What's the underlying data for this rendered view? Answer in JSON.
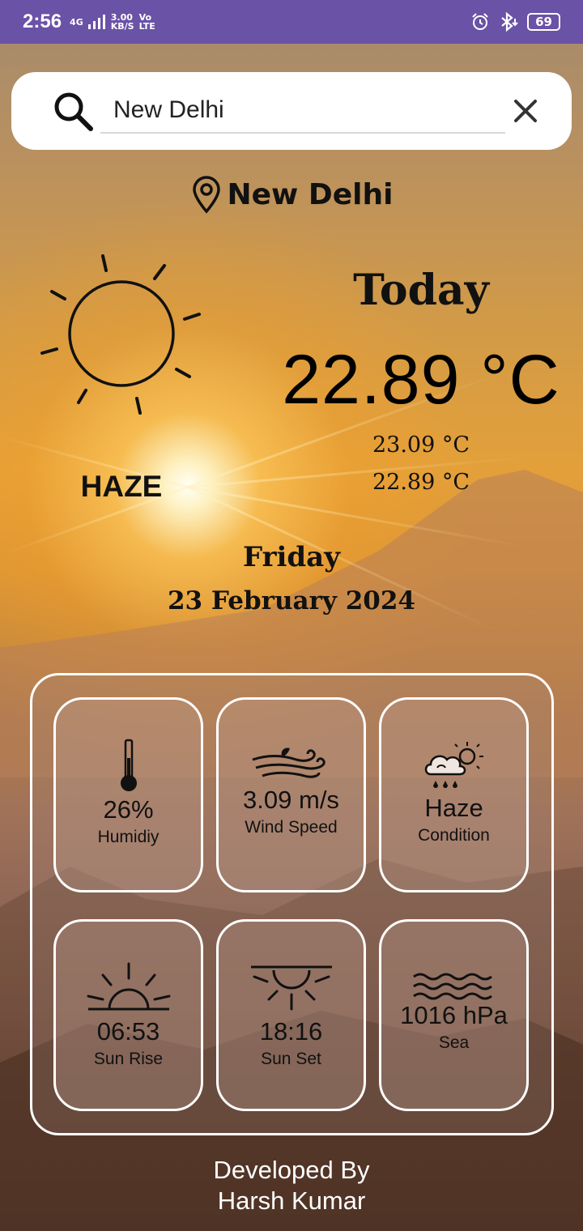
{
  "status_bar": {
    "time": "2:56",
    "network": "4G",
    "speed_value": "3.00",
    "speed_unit": "KB/S",
    "volte_top": "Vo",
    "volte_bottom": "LTE",
    "battery": "69"
  },
  "search": {
    "value": "New Delhi"
  },
  "location": {
    "city": "New Delhi"
  },
  "weather": {
    "today_label": "Today",
    "temperature": "22.89 °C",
    "max_temp": "23.09 °C",
    "min_temp": "22.89 °C",
    "condition": "HAZE",
    "day": "Friday",
    "date": "23 February 2024"
  },
  "cards": [
    {
      "value": "26%",
      "label": "Humidiy",
      "icon": "thermometer-icon"
    },
    {
      "value": "3.09 m/s",
      "label": "Wind Speed",
      "icon": "wind-icon"
    },
    {
      "value": "Haze",
      "label": "Condition",
      "icon": "cloud-rain-sun-icon"
    },
    {
      "value": "06:53",
      "label": "Sun Rise",
      "icon": "sunrise-icon"
    },
    {
      "value": "18:16",
      "label": "Sun Set",
      "icon": "sunset-icon"
    },
    {
      "value": "1016 hPa",
      "label": "Sea",
      "icon": "waves-icon"
    }
  ],
  "footer": {
    "line1": "Developed By",
    "line2": "Harsh Kumar"
  },
  "colors": {
    "status_bar": "#6a52a6",
    "card_border": "#ffffff"
  }
}
